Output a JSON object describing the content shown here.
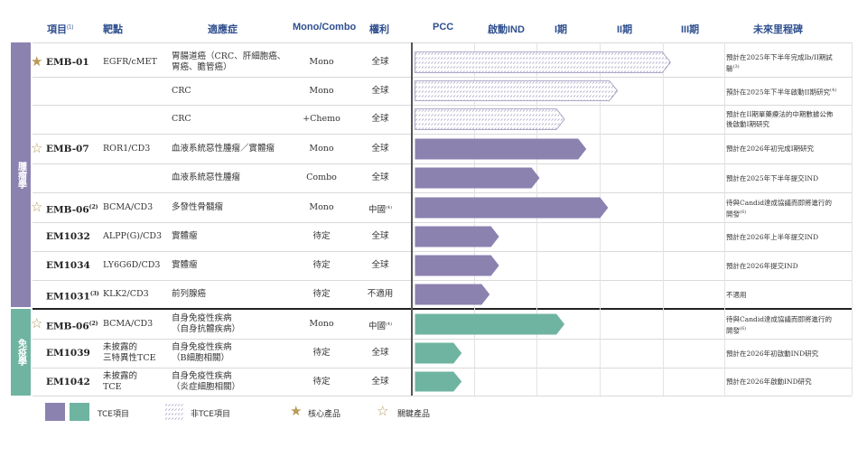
{
  "headers": {
    "project": "項目",
    "project_note": "(1)",
    "target": "靶點",
    "indication": "適應症",
    "mono_combo": "Mono/Combo",
    "rights": "權利",
    "pcc": "PCC",
    "ind": "啟動IND",
    "phase1": "I期",
    "phase2": "II期",
    "phase3": "III期",
    "milestone": "未來里程碑"
  },
  "groups": [
    {
      "label": "腫瘤學",
      "color": "#8b82b0"
    },
    {
      "label": "免疫學",
      "color": "#6fb4a0"
    }
  ],
  "rows": [
    {
      "star": "core",
      "project": "EMB-01",
      "project_note": "",
      "target": "EGFR/cMET",
      "indication_lines": [
        "胃腸道癌（CRC、肝細胞癌、",
        "胃癌、膽管癌）"
      ],
      "mode": "Mono",
      "rights": "全球",
      "rights_note": "",
      "milestone_lines": [
        "預計在2025年下半年完成Ib/II期試",
        "驗"
      ],
      "milestone_note": "(3)",
      "bar": {
        "progress": 4.15,
        "style": "hatched",
        "group": 0
      }
    },
    {
      "star": "",
      "project": "",
      "project_note": "",
      "target": "",
      "indication_lines": [
        "CRC"
      ],
      "mode": "Mono",
      "rights": "全球",
      "rights_note": "",
      "milestone_lines": [
        "預計在2025年下半年啟動II期研究"
      ],
      "milestone_note": "(4)",
      "bar": {
        "progress": 3.3,
        "style": "hatched",
        "group": 0
      }
    },
    {
      "star": "",
      "project": "",
      "project_note": "",
      "target": "",
      "indication_lines": [
        "CRC"
      ],
      "mode": "+Chemo",
      "rights": "全球",
      "rights_note": "",
      "milestone_lines": [
        "預計在II期單藥療法的中期數據公佈",
        "後啟動I期研究"
      ],
      "milestone_note": "",
      "bar": {
        "progress": 2.45,
        "style": "hatched",
        "group": 0
      }
    },
    {
      "star": "key",
      "project": "EMB-07",
      "project_note": "",
      "target": "ROR1/CD3",
      "indication_lines": [
        "血液系統惡性腫瘤／實體瘤"
      ],
      "mode": "Mono",
      "rights": "全球",
      "rights_note": "",
      "milestone_lines": [
        "預計在2026年初完成I期研究"
      ],
      "milestone_note": "",
      "bar": {
        "progress": 2.8,
        "style": "solid",
        "group": 0
      }
    },
    {
      "star": "",
      "project": "",
      "project_note": "",
      "target": "",
      "indication_lines": [
        "血液系統惡性腫瘤"
      ],
      "mode": "Combo",
      "rights": "全球",
      "rights_note": "",
      "milestone_lines": [
        "預計在2025年下半年提交IND"
      ],
      "milestone_note": "",
      "bar": {
        "progress": 2.05,
        "style": "solid",
        "group": 0
      }
    },
    {
      "star": "key",
      "project": "EMB-06",
      "project_note": "(2)",
      "target": "BCMA/CD3",
      "indication_lines": [
        "多發性骨髓瘤"
      ],
      "mode": "Mono",
      "rights": "中國",
      "rights_note": "(4)",
      "milestone_lines": [
        "待與Candid達成協議而即將進行的",
        "開發"
      ],
      "milestone_note": "(6)",
      "bar": {
        "progress": 3.15,
        "style": "solid",
        "group": 0
      }
    },
    {
      "star": "",
      "project": "EM1032",
      "project_note": "",
      "target": "ALPP(G)/CD3",
      "indication_lines": [
        "實體瘤"
      ],
      "mode": "待定",
      "rights": "全球",
      "rights_note": "",
      "milestone_lines": [
        "預計在2026年上半年提交IND"
      ],
      "milestone_note": "",
      "bar": {
        "progress": 1.4,
        "style": "solid",
        "group": 0
      }
    },
    {
      "star": "",
      "project": "EM1034",
      "project_note": "",
      "target": "LY6G6D/CD3",
      "indication_lines": [
        "實體瘤"
      ],
      "mode": "待定",
      "rights": "全球",
      "rights_note": "",
      "milestone_lines": [
        "預計在2026年提交IND"
      ],
      "milestone_note": "",
      "bar": {
        "progress": 1.4,
        "style": "solid",
        "group": 0
      }
    },
    {
      "star": "",
      "project": "EM1031",
      "project_note": "(3)",
      "target": "KLK2/CD3",
      "indication_lines": [
        "前列腺癌"
      ],
      "mode": "待定",
      "rights": "不適用",
      "rights_note": "",
      "milestone_lines": [
        "不適用"
      ],
      "milestone_note": "",
      "bar": {
        "progress": 1.25,
        "style": "solid",
        "group": 0
      }
    },
    {
      "star": "key",
      "project": "EMB-06",
      "project_note": "(2)",
      "target": "BCMA/CD3",
      "indication_lines": [
        "自身免疫性疾病",
        "（自身抗體疾病）"
      ],
      "mode": "Mono",
      "rights": "中國",
      "rights_note": "(4)",
      "milestone_lines": [
        "待與Candid達成協議而即將進行的",
        "開發"
      ],
      "milestone_note": "(6)",
      "bar": {
        "progress": 2.45,
        "style": "solid",
        "group": 1
      }
    },
    {
      "star": "",
      "project": "EM1039",
      "project_note": "",
      "target": "未披露的|三特異性TCE",
      "indication_lines": [
        "自身免疫性疾病",
        "（B細胞相關）"
      ],
      "mode": "待定",
      "rights": "全球",
      "rights_note": "",
      "milestone_lines": [
        "預計在2026年初啟動IND研究"
      ],
      "milestone_note": "",
      "bar": {
        "progress": 0.8,
        "style": "solid",
        "group": 1
      }
    },
    {
      "star": "",
      "project": "EM1042",
      "project_note": "",
      "target": "未披露的|TCE",
      "indication_lines": [
        "自身免疫性疾病",
        "（炎症細胞相關）"
      ],
      "mode": "待定",
      "rights": "全球",
      "rights_note": "",
      "milestone_lines": [
        "預計在2026年啟動IND研究"
      ],
      "milestone_note": "",
      "bar": {
        "progress": 0.8,
        "style": "solid",
        "group": 1
      }
    }
  ],
  "legend": {
    "tce": "TCE項目",
    "non_tce": "非TCE項目",
    "core": "核心產品",
    "key": "關鍵產品"
  },
  "colors": {
    "oncology": "#8b82b0",
    "immunology": "#6fb4a0",
    "star": "#b79a55",
    "header": "#2f4f8f"
  }
}
